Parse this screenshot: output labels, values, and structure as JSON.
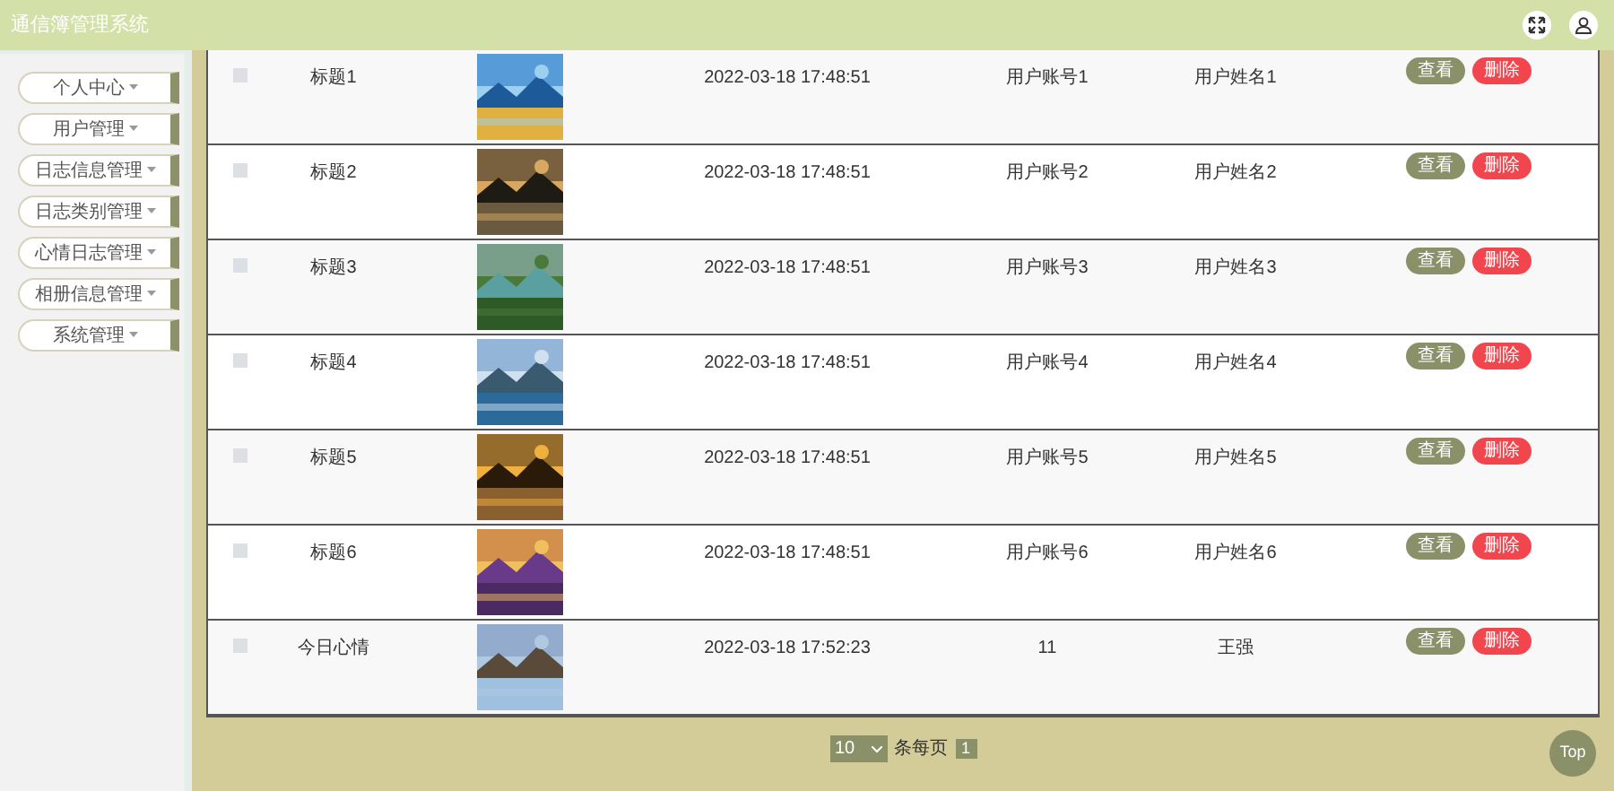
{
  "header": {
    "title": "通信簿管理系统"
  },
  "sidebar": {
    "items": [
      {
        "label": "个人中心"
      },
      {
        "label": "用户管理"
      },
      {
        "label": "日志信息管理"
      },
      {
        "label": "日志类别管理"
      },
      {
        "label": "心情日志管理"
      },
      {
        "label": "相册信息管理"
      },
      {
        "label": "系统管理"
      }
    ]
  },
  "table": {
    "rows": [
      {
        "checked": false,
        "title": "标题1",
        "time": "2022-03-18 17:48:51",
        "account": "用户账号1",
        "name": "用户姓名1",
        "actions": [
          "查看",
          "删除"
        ]
      },
      {
        "checked": false,
        "title": "标题2",
        "time": "2022-03-18 17:48:51",
        "account": "用户账号2",
        "name": "用户姓名2",
        "actions": [
          "查看",
          "删除"
        ]
      },
      {
        "checked": false,
        "title": "标题3",
        "time": "2022-03-18 17:48:51",
        "account": "用户账号3",
        "name": "用户姓名3",
        "actions": [
          "查看",
          "删除"
        ]
      },
      {
        "checked": false,
        "title": "标题4",
        "time": "2022-03-18 17:48:51",
        "account": "用户账号4",
        "name": "用户姓名4",
        "actions": [
          "查看",
          "删除"
        ]
      },
      {
        "checked": false,
        "title": "标题5",
        "time": "2022-03-18 17:48:51",
        "account": "用户账号5",
        "name": "用户姓名5",
        "actions": [
          "查看",
          "删除"
        ]
      },
      {
        "checked": false,
        "title": "标题6",
        "time": "2022-03-18 17:48:51",
        "account": "用户账号6",
        "name": "用户姓名6",
        "actions": [
          "查看",
          "删除"
        ]
      },
      {
        "checked": false,
        "title": "今日心情",
        "time": "2022-03-18 17:52:23",
        "account": "11",
        "name": "王强",
        "actions": [
          "查看",
          "删除"
        ]
      }
    ]
  },
  "pagination": {
    "page_size": "10",
    "page_size_label": "条每页",
    "pages": [
      {
        "label": "1",
        "selected": true
      }
    ]
  },
  "top_button": "Top"
}
